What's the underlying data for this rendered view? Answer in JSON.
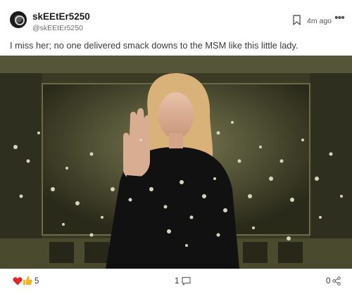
{
  "post": {
    "display_name": "skEEtEr5250",
    "handle": "@skEEtEr5250",
    "time": "4m ago",
    "more_label": "•••",
    "text": "I miss her; no one delivered smack downs to the MSM like this little lady.",
    "media_icon": "photo-meme-image"
  },
  "footer": {
    "reaction_icons": [
      "heart-icon",
      "thumbs-up-icon"
    ],
    "reactions": "5",
    "comments": "1",
    "shares": "0"
  },
  "colors": {
    "heart": "#e0262b",
    "thumb": "#f2b31c",
    "icon_gray": "#666666"
  }
}
